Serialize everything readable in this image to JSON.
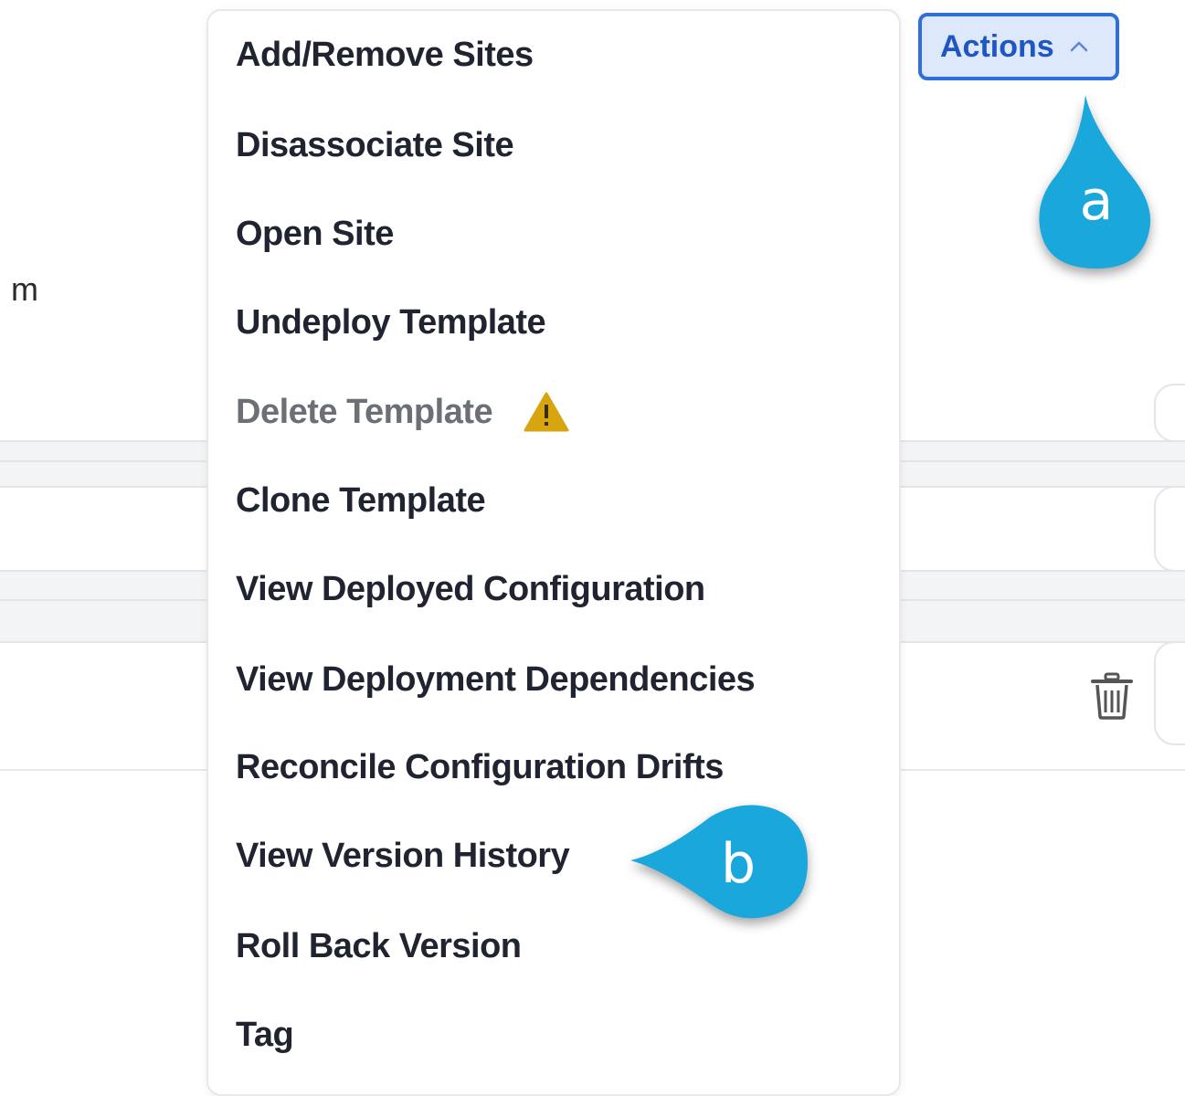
{
  "background": {
    "partial_text": "m"
  },
  "menu": {
    "items": [
      {
        "label": "Add/Remove Sites",
        "disabled": false
      },
      {
        "label": "Disassociate Site",
        "disabled": false
      },
      {
        "label": "Open Site",
        "disabled": false
      },
      {
        "label": "Undeploy Template",
        "disabled": false
      },
      {
        "label": "Delete Template",
        "disabled": true,
        "icon": "warning-icon"
      },
      {
        "label": "Clone Template",
        "disabled": false
      },
      {
        "label": "View Deployed Configuration",
        "disabled": false
      },
      {
        "label": "View Deployment Dependencies",
        "disabled": false
      },
      {
        "label": "Reconcile Configuration Drifts",
        "disabled": false
      },
      {
        "label": "View Version History",
        "disabled": false
      },
      {
        "label": "Roll Back Version",
        "disabled": false
      },
      {
        "label": "Tag",
        "disabled": false
      }
    ]
  },
  "actions_button": {
    "label": "Actions",
    "icon": "chevron-up-icon"
  },
  "callouts": {
    "a": "a",
    "b": "b"
  },
  "icons": {
    "trash": "trash-icon",
    "warning": "warning-icon"
  },
  "colors": {
    "accent": "#2f6fd9",
    "button_bg": "#dde8fb",
    "callout": "#1aa7dc",
    "warning": "#d6a50f",
    "disabled_text": "#6b6f76"
  }
}
